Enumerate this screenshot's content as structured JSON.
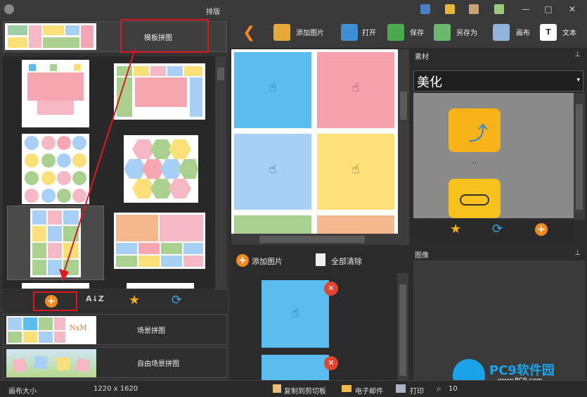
{
  "window": {
    "title": "排版"
  },
  "left_panel": {
    "top_item_label": "模板拼图",
    "bottom_items": [
      {
        "label": "场景拼图",
        "thumb_text": "NxM"
      },
      {
        "label": "自由场景拼图"
      }
    ]
  },
  "toolbar": {
    "add_image": "添加图片",
    "open": "打开",
    "save": "保存",
    "save_as": "另存为",
    "canvas": "画布",
    "text": "文本"
  },
  "bottom_panel": {
    "add_image": "添加图片",
    "clear_all": "全部清除"
  },
  "right_panel": {
    "material_header": "素材",
    "combo_value": "美化",
    "dots": "..",
    "image_header": "图像",
    "watermark_brand": "PC9软件园",
    "watermark_url": "www.PC9.com"
  },
  "status": {
    "canvas_size_label": "画布大小",
    "canvas_size_value": "1220 x 1620",
    "copy": "复制到剪切板",
    "email": "电子邮件",
    "print": "打印",
    "zoom": "10"
  },
  "colors": {
    "accent": "#f08a1c",
    "highlight_red": "#e0181e",
    "tile_blue": "#5bbcf0",
    "tile_pink": "#f7a0ae",
    "tile_lightblue": "#a8cff5",
    "tile_yellow": "#fbe07a",
    "tile_green": "#a9d08e",
    "tile_salmon": "#f6b88e"
  }
}
